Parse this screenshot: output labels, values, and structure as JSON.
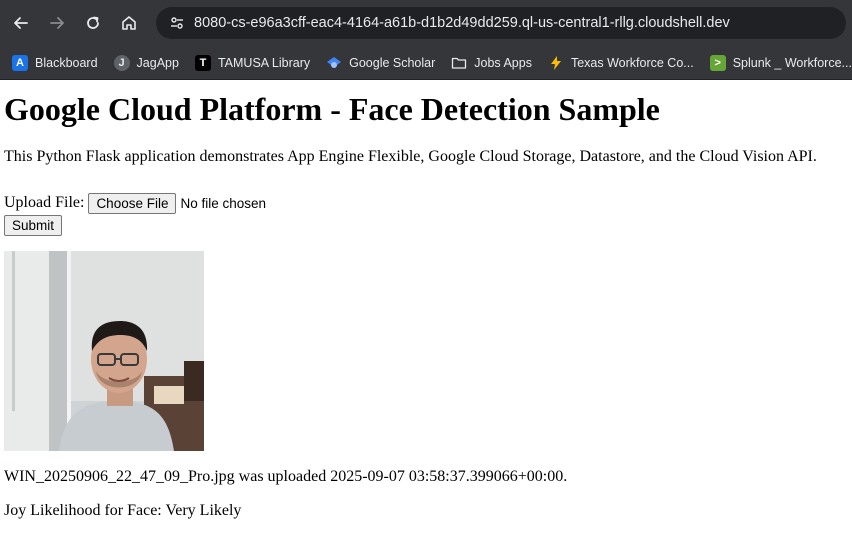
{
  "browser": {
    "url": "8080-cs-e96a3cff-eac4-4164-a61b-d1b2d49dd259.ql-us-central1-rllg.cloudshell.dev",
    "nav_icons": [
      "back-icon",
      "forward-icon",
      "reload-icon",
      "home-icon",
      "site-settings-icon"
    ],
    "bookmarks": [
      {
        "label": "Blackboard",
        "icon": "blackboard-icon",
        "color": "#1a73e8"
      },
      {
        "label": "JagApp",
        "icon": "jagapp-icon",
        "color": "#e8eaed"
      },
      {
        "label": "TAMUSA Library",
        "icon": "tamusa-library-icon",
        "color": "#ffffff"
      },
      {
        "label": "Google Scholar",
        "icon": "google-scholar-icon",
        "color": "#4285f4"
      },
      {
        "label": "Jobs Apps",
        "icon": "folder-icon",
        "color": "#e8eaed"
      },
      {
        "label": "Texas Workforce Co...",
        "icon": "lightning-icon",
        "color": "#fbbc04"
      },
      {
        "label": "Splunk _ Workforce...",
        "icon": "splunk-icon",
        "color": "#65a637"
      }
    ]
  },
  "page": {
    "title": "Google Cloud Platform - Face Detection Sample",
    "description": "This Python Flask application demonstrates App Engine Flexible, Google Cloud Storage, Datastore, and the Cloud Vision API.",
    "upload_label": "Upload File:",
    "choose_file_label": "Choose File",
    "file_status": "No file chosen",
    "submit_label": "Submit",
    "uploaded_text": "WIN_20250906_22_47_09_Pro.jpg was uploaded 2025-09-07 03:58:37.399066+00:00.",
    "joy_text": "Joy Likelihood for Face: Very Likely"
  },
  "colors": {
    "chrome_bg": "#35363a",
    "omnibox_bg": "#202124",
    "chrome_text": "#e8eaed"
  }
}
